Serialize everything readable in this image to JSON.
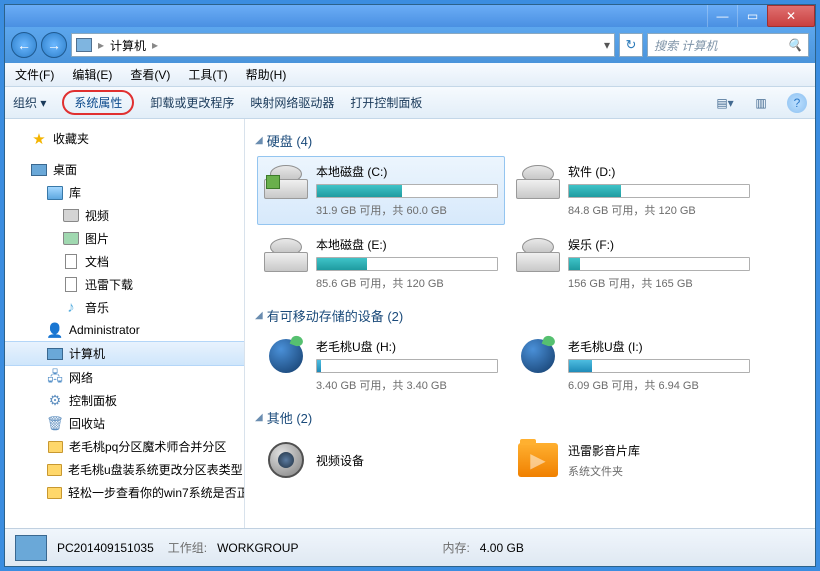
{
  "titlebar": {
    "min": "—",
    "max": "▭",
    "close": "✕"
  },
  "nav": {
    "back": "←",
    "forward": "→",
    "icon": "",
    "path": "计算机",
    "sep": "▸",
    "drop": "▾",
    "refresh": "↻"
  },
  "search": {
    "placeholder": "搜索 计算机",
    "icon": "🔍"
  },
  "menubar": {
    "file": "文件(F)",
    "edit": "编辑(E)",
    "view": "查看(V)",
    "tools": "工具(T)",
    "help": "帮助(H)"
  },
  "toolbar": {
    "organize": "组织 ▾",
    "sysprops": "系统属性",
    "uninstall": "卸载或更改程序",
    "mapdrive": "映射网络驱动器",
    "ctrlpanel": "打开控制面板",
    "viewicon": "▤▾",
    "preview": "▥",
    "help": "?"
  },
  "sidebar": {
    "fav": "收藏夹",
    "desktop": "桌面",
    "lib": "库",
    "video": "视频",
    "pic": "图片",
    "doc": "文档",
    "xl": "迅雷下载",
    "music": "音乐",
    "admin": "Administrator",
    "computer": "计算机",
    "network": "网络",
    "ctrl": "控制面板",
    "bin": "回收站",
    "f1": "老毛桃pq分区魔术师合并分区",
    "f2": "老毛桃u盘装系统更改分区表类型",
    "f3": "轻松一步查看你的win7系统是否正"
  },
  "sections": {
    "hdd": "硬盘 (4)",
    "removable": "有可移动存储的设备 (2)",
    "other": "其他 (2)"
  },
  "drives": {
    "c": {
      "name": "本地磁盘 (C:)",
      "stat": "31.9 GB 可用，共 60.0 GB",
      "fill": "47%"
    },
    "d": {
      "name": "软件 (D:)",
      "stat": "84.8 GB 可用，共 120 GB",
      "fill": "29%"
    },
    "e": {
      "name": "本地磁盘 (E:)",
      "stat": "85.6 GB 可用，共 120 GB",
      "fill": "28%"
    },
    "f": {
      "name": "娱乐 (F:)",
      "stat": "156 GB 可用，共 165 GB",
      "fill": "6%"
    },
    "h": {
      "name": "老毛桃U盘 (H:)",
      "stat": "3.40 GB 可用，共 3.40 GB",
      "fill": "2%"
    },
    "i": {
      "name": "老毛桃U盘 (I:)",
      "stat": "6.09 GB 可用，共 6.94 GB",
      "fill": "13%"
    }
  },
  "other": {
    "video": "视频设备",
    "xunlei": "迅雷影音片库",
    "xunlei_sub": "系统文件夹"
  },
  "status": {
    "name": "PC201409151035",
    "wg_label": "工作组:",
    "wg": "WORKGROUP",
    "mem_label": "内存:",
    "mem": "4.00 GB"
  }
}
